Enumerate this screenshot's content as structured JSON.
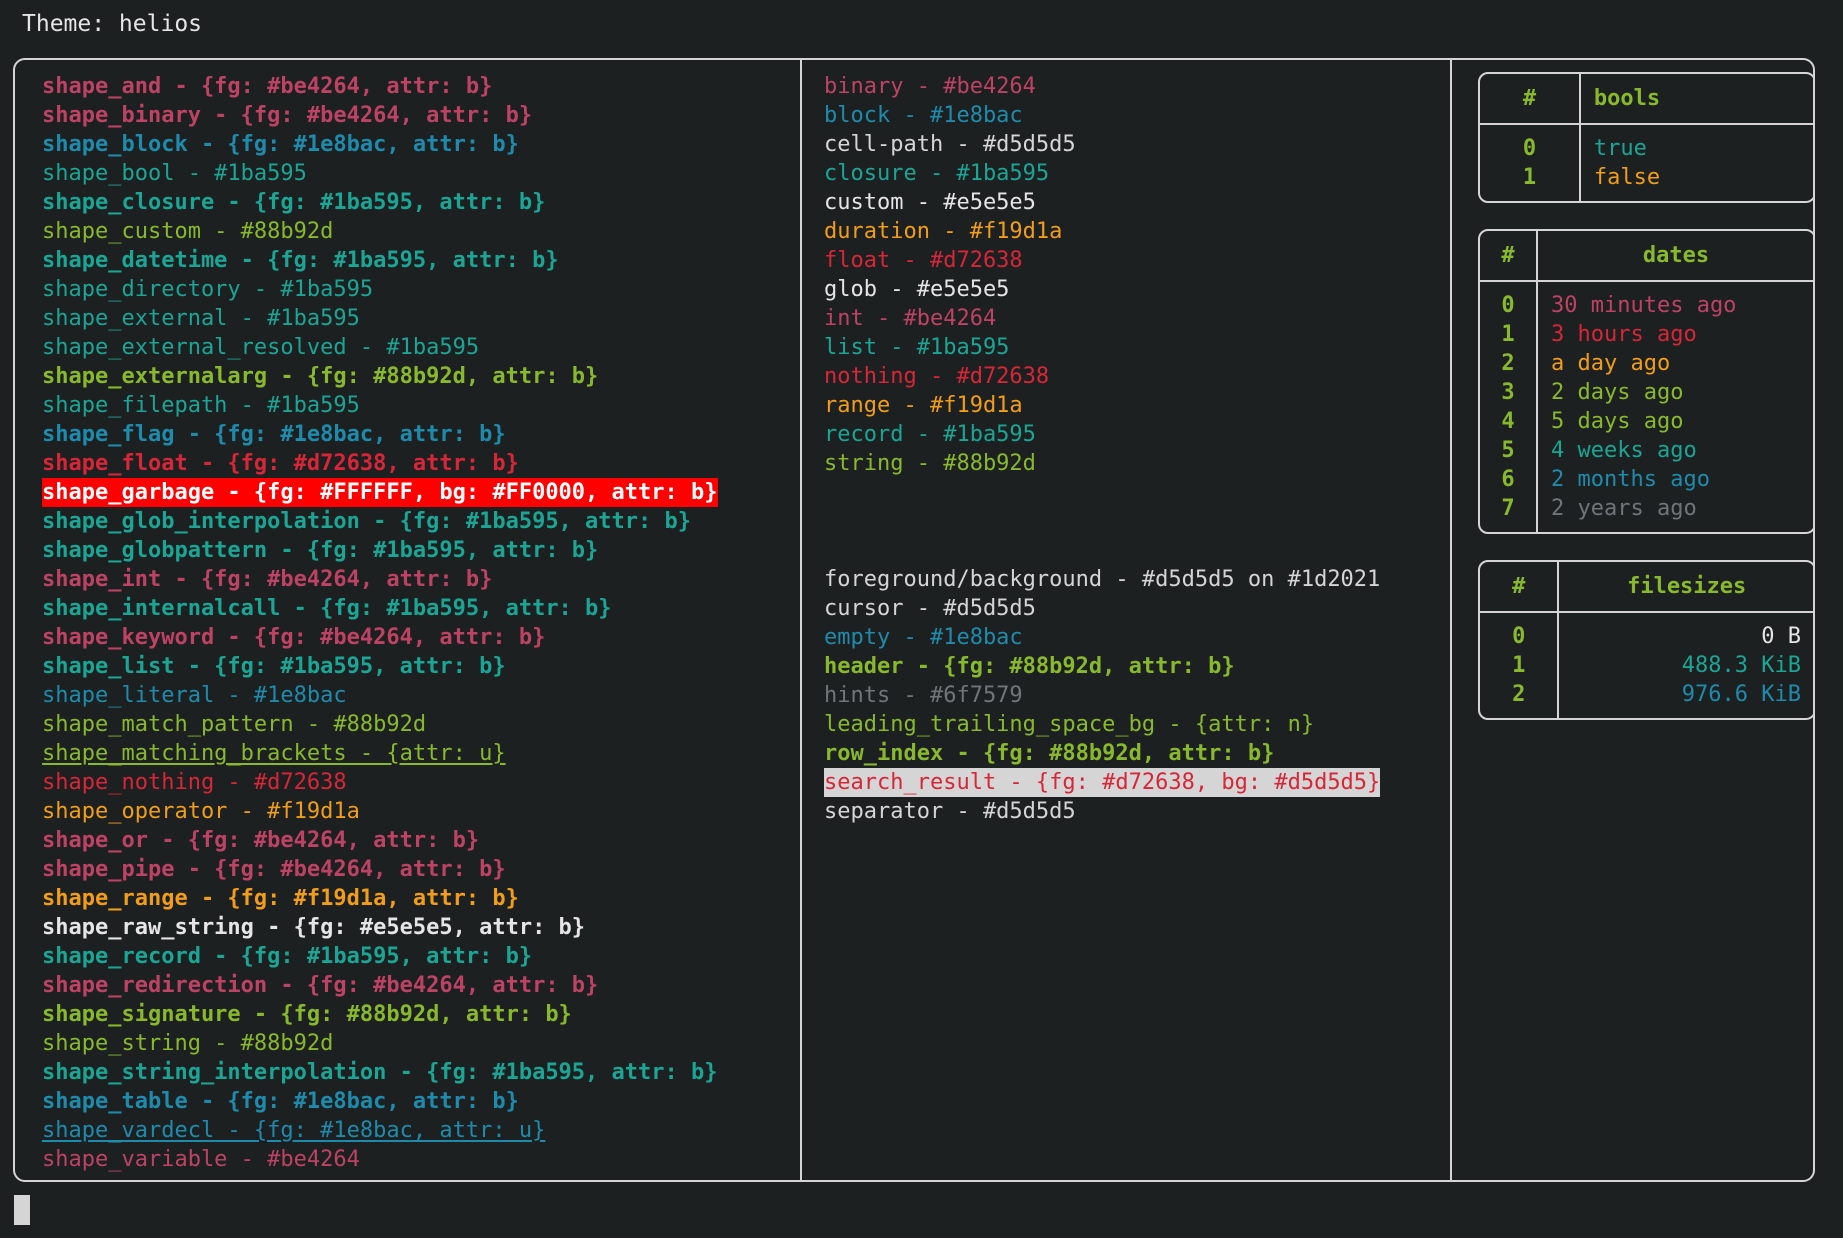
{
  "title": "Theme: helios",
  "palette": {
    "bg": "#1d2021",
    "fg": "#d5d5d5",
    "pink": "#be4264",
    "blue": "#1e8bac",
    "teal": "#1ba595",
    "green": "#88b92d",
    "orange": "#f19d1a",
    "red": "#d72638",
    "white": "#e5e5e5",
    "dim": "#6f7579",
    "garbage_bg": "#FF0000",
    "search_result_bg": "#d5d5d5",
    "border": "#d5d5d5"
  },
  "shapes": [
    {
      "text": "shape_and - {fg: #be4264, attr: b}",
      "color": "pink",
      "bold": true
    },
    {
      "text": "shape_binary - {fg: #be4264, attr: b}",
      "color": "pink",
      "bold": true
    },
    {
      "text": "shape_block - {fg: #1e8bac, attr: b}",
      "color": "blue",
      "bold": true
    },
    {
      "text": "shape_bool - #1ba595",
      "color": "teal",
      "bold": false
    },
    {
      "text": "shape_closure - {fg: #1ba595, attr: b}",
      "color": "teal",
      "bold": true
    },
    {
      "text": "shape_custom - #88b92d",
      "color": "green",
      "bold": false
    },
    {
      "text": "shape_datetime - {fg: #1ba595, attr: b}",
      "color": "teal",
      "bold": true
    },
    {
      "text": "shape_directory - #1ba595",
      "color": "teal",
      "bold": false
    },
    {
      "text": "shape_external - #1ba595",
      "color": "teal",
      "bold": false
    },
    {
      "text": "shape_external_resolved - #1ba595",
      "color": "teal",
      "bold": false
    },
    {
      "text": "shape_externalarg - {fg: #88b92d, attr: b}",
      "color": "green",
      "bold": true
    },
    {
      "text": "shape_filepath - #1ba595",
      "color": "teal",
      "bold": false
    },
    {
      "text": "shape_flag - {fg: #1e8bac, attr: b}",
      "color": "blue",
      "bold": true
    },
    {
      "text": "shape_float - {fg: #d72638, attr: b}",
      "color": "red",
      "bold": true
    },
    {
      "text": "shape_garbage - {fg: #FFFFFF, bg: #FF0000, attr: b}",
      "color": "garbage",
      "bold": true
    },
    {
      "text": "shape_glob_interpolation - {fg: #1ba595, attr: b}",
      "color": "teal",
      "bold": true
    },
    {
      "text": "shape_globpattern - {fg: #1ba595, attr: b}",
      "color": "teal",
      "bold": true
    },
    {
      "text": "shape_int - {fg: #be4264, attr: b}",
      "color": "pink",
      "bold": true
    },
    {
      "text": "shape_internalcall - {fg: #1ba595, attr: b}",
      "color": "teal",
      "bold": true
    },
    {
      "text": "shape_keyword - {fg: #be4264, attr: b}",
      "color": "pink",
      "bold": true
    },
    {
      "text": "shape_list - {fg: #1ba595, attr: b}",
      "color": "teal",
      "bold": true
    },
    {
      "text": "shape_literal - #1e8bac",
      "color": "blue",
      "bold": false
    },
    {
      "text": "shape_match_pattern - #88b92d",
      "color": "green",
      "bold": false
    },
    {
      "text": "shape_matching_brackets - {attr: u}",
      "color": "green",
      "bold": false,
      "underline": true
    },
    {
      "text": "shape_nothing - #d72638",
      "color": "red",
      "bold": false
    },
    {
      "text": "shape_operator - #f19d1a",
      "color": "orange",
      "bold": false
    },
    {
      "text": "shape_or - {fg: #be4264, attr: b}",
      "color": "pink",
      "bold": true
    },
    {
      "text": "shape_pipe - {fg: #be4264, attr: b}",
      "color": "pink",
      "bold": true
    },
    {
      "text": "shape_range - {fg: #f19d1a, attr: b}",
      "color": "orange",
      "bold": true
    },
    {
      "text": "shape_raw_string - {fg: #e5e5e5, attr: b}",
      "color": "white",
      "bold": true
    },
    {
      "text": "shape_record - {fg: #1ba595, attr: b}",
      "color": "teal",
      "bold": true
    },
    {
      "text": "shape_redirection - {fg: #be4264, attr: b}",
      "color": "pink",
      "bold": true
    },
    {
      "text": "shape_signature - {fg: #88b92d, attr: b}",
      "color": "green",
      "bold": true
    },
    {
      "text": "shape_string - #88b92d",
      "color": "green",
      "bold": false
    },
    {
      "text": "shape_string_interpolation - {fg: #1ba595, attr: b}",
      "color": "teal",
      "bold": true
    },
    {
      "text": "shape_table - {fg: #1e8bac, attr: b}",
      "color": "blue",
      "bold": true
    },
    {
      "text": "shape_vardecl - {fg: #1e8bac, attr: u}",
      "color": "blue",
      "bold": false,
      "underline": true
    },
    {
      "text": "shape_variable - #be4264",
      "color": "pink",
      "bold": false
    }
  ],
  "types": [
    {
      "text": "binary - #be4264",
      "color": "pink",
      "bold": false
    },
    {
      "text": "block - #1e8bac",
      "color": "blue",
      "bold": false
    },
    {
      "text": "cell-path - #d5d5d5",
      "color": "grey",
      "bold": false
    },
    {
      "text": "closure - #1ba595",
      "color": "teal",
      "bold": false
    },
    {
      "text": "custom - #e5e5e5",
      "color": "white",
      "bold": false
    },
    {
      "text": "duration - #f19d1a",
      "color": "orange",
      "bold": false
    },
    {
      "text": "float - #d72638",
      "color": "red",
      "bold": false
    },
    {
      "text": "glob - #e5e5e5",
      "color": "white",
      "bold": false
    },
    {
      "text": "int - #be4264",
      "color": "pink",
      "bold": false
    },
    {
      "text": "list - #1ba595",
      "color": "teal",
      "bold": false
    },
    {
      "text": "nothing - #d72638",
      "color": "red",
      "bold": false
    },
    {
      "text": "range - #f19d1a",
      "color": "orange",
      "bold": false
    },
    {
      "text": "record - #1ba595",
      "color": "teal",
      "bold": false
    },
    {
      "text": "string - #88b92d",
      "color": "green",
      "bold": false
    }
  ],
  "ui_elements": [
    {
      "text": "foreground/background - #d5d5d5 on #1d2021",
      "color": "grey",
      "bold": false
    },
    {
      "text": "cursor - #d5d5d5",
      "color": "grey",
      "bold": false
    },
    {
      "text": "empty - #1e8bac",
      "color": "blue",
      "bold": false
    },
    {
      "text": "header - {fg: #88b92d, attr: b}",
      "color": "green",
      "bold": true
    },
    {
      "text": "hints - #6f7579",
      "color": "dim",
      "bold": false
    },
    {
      "text": "leading_trailing_space_bg - {attr: n}",
      "color": "green",
      "bold": false
    },
    {
      "text": "row_index - {fg: #88b92d, attr: b}",
      "color": "green",
      "bold": true
    },
    {
      "text": "search_result - {fg: #d72638, bg: #d5d5d5}",
      "color": "search",
      "bold": false
    },
    {
      "text": "separator - #d5d5d5",
      "color": "grey",
      "bold": false
    }
  ],
  "tables": {
    "bools": {
      "index_header": "#",
      "header": "bools",
      "rows": [
        {
          "index": "0",
          "value": "true",
          "color": "teal",
          "bold": false
        },
        {
          "index": "1",
          "value": "false",
          "color": "orange",
          "bold": false
        }
      ]
    },
    "dates": {
      "index_header": "#",
      "header": "dates",
      "rows": [
        {
          "index": "0",
          "value": "30 minutes ago",
          "color": "pink",
          "bold": true
        },
        {
          "index": "1",
          "value": "3 hours ago",
          "color": "red",
          "bold": false
        },
        {
          "index": "2",
          "value": "a day ago",
          "color": "orange",
          "bold": false
        },
        {
          "index": "3",
          "value": "2 days ago",
          "color": "green",
          "bold": false
        },
        {
          "index": "4",
          "value": "5 days ago",
          "color": "green",
          "bold": true
        },
        {
          "index": "5",
          "value": "4 weeks ago",
          "color": "teal",
          "bold": false
        },
        {
          "index": "6",
          "value": "2 months ago",
          "color": "blue",
          "bold": false
        },
        {
          "index": "7",
          "value": "2 years ago",
          "color": "dim",
          "bold": false
        }
      ]
    },
    "filesizes": {
      "index_header": "#",
      "header": "filesizes",
      "rows": [
        {
          "index": "0",
          "value": "0 B",
          "color": "white",
          "bold": false
        },
        {
          "index": "1",
          "value": "488.3 KiB",
          "color": "teal",
          "bold": false
        },
        {
          "index": "2",
          "value": "976.6 KiB",
          "color": "blue",
          "bold": false
        }
      ]
    }
  }
}
